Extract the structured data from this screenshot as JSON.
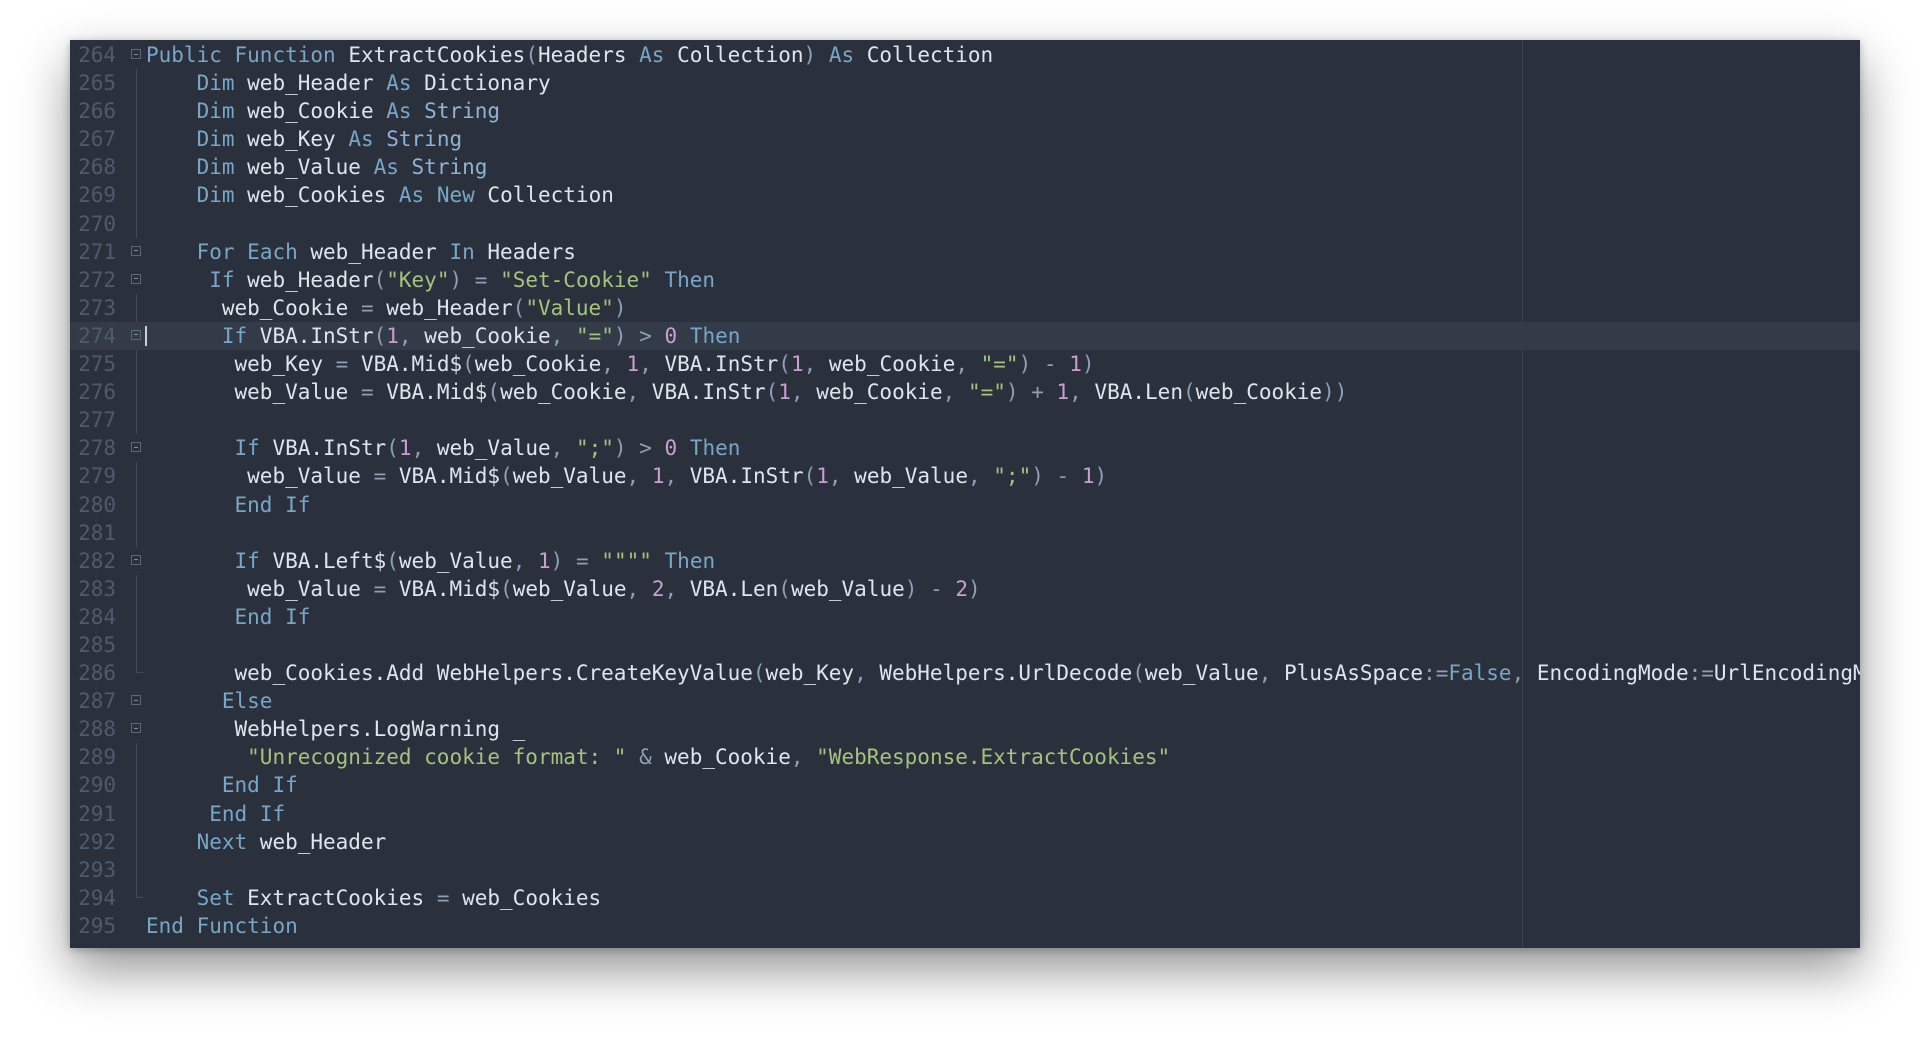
{
  "editor": {
    "language": "VBA",
    "current_line": "274",
    "lines": [
      {
        "num": "264",
        "fold": "start",
        "indent": "",
        "tokens": [
          [
            "kw",
            "Public"
          ],
          [
            "id",
            " "
          ],
          [
            "kw",
            "Function"
          ],
          [
            "id",
            " ExtractCookies"
          ],
          [
            "op",
            "("
          ],
          [
            "id",
            "Headers "
          ],
          [
            "kw",
            "As"
          ],
          [
            "id",
            " Collection"
          ],
          [
            "op",
            ")"
          ],
          [
            "id",
            " "
          ],
          [
            "kw",
            "As"
          ],
          [
            "id",
            " Collection"
          ]
        ]
      },
      {
        "num": "265",
        "fold": "line",
        "indent": "    ",
        "tokens": [
          [
            "kw",
            "Dim"
          ],
          [
            "id",
            " web_Header "
          ],
          [
            "kw",
            "As"
          ],
          [
            "id",
            " Dictionary"
          ]
        ]
      },
      {
        "num": "266",
        "fold": "line",
        "indent": "    ",
        "tokens": [
          [
            "kw",
            "Dim"
          ],
          [
            "id",
            " web_Cookie "
          ],
          [
            "kw",
            "As"
          ],
          [
            "kw2",
            " String"
          ]
        ]
      },
      {
        "num": "267",
        "fold": "line",
        "indent": "    ",
        "tokens": [
          [
            "kw",
            "Dim"
          ],
          [
            "id",
            " web_Key "
          ],
          [
            "kw",
            "As"
          ],
          [
            "kw2",
            " String"
          ]
        ]
      },
      {
        "num": "268",
        "fold": "line",
        "indent": "    ",
        "tokens": [
          [
            "kw",
            "Dim"
          ],
          [
            "id",
            " web_Value "
          ],
          [
            "kw",
            "As"
          ],
          [
            "kw2",
            " String"
          ]
        ]
      },
      {
        "num": "269",
        "fold": "line",
        "indent": "    ",
        "tokens": [
          [
            "kw",
            "Dim"
          ],
          [
            "id",
            " web_Cookies "
          ],
          [
            "kw",
            "As"
          ],
          [
            "id",
            " "
          ],
          [
            "kw",
            "New"
          ],
          [
            "id",
            " Collection"
          ]
        ]
      },
      {
        "num": "270",
        "fold": "line",
        "indent": "",
        "tokens": []
      },
      {
        "num": "271",
        "fold": "start",
        "indent": "    ",
        "tokens": [
          [
            "kw",
            "For"
          ],
          [
            "id",
            " "
          ],
          [
            "kw",
            "Each"
          ],
          [
            "id",
            " web_Header "
          ],
          [
            "kw",
            "In"
          ],
          [
            "id",
            " Headers"
          ]
        ]
      },
      {
        "num": "272",
        "fold": "start",
        "indent": "     ",
        "tokens": [
          [
            "kw",
            "If"
          ],
          [
            "id",
            " web_Header"
          ],
          [
            "op",
            "("
          ],
          [
            "str",
            "\"Key\""
          ],
          [
            "op",
            ")"
          ],
          [
            "id",
            " "
          ],
          [
            "op",
            "="
          ],
          [
            "id",
            " "
          ],
          [
            "str",
            "\"Set-Cookie\""
          ],
          [
            "id",
            " "
          ],
          [
            "kw",
            "Then"
          ]
        ]
      },
      {
        "num": "273",
        "fold": "line",
        "indent": "      ",
        "tokens": [
          [
            "id",
            "web_Cookie "
          ],
          [
            "op",
            "="
          ],
          [
            "id",
            " web_Header"
          ],
          [
            "op",
            "("
          ],
          [
            "str",
            "\"Value\""
          ],
          [
            "op",
            ")"
          ]
        ]
      },
      {
        "num": "274",
        "fold": "start",
        "indent": "      ",
        "tokens": [
          [
            "kw",
            "If"
          ],
          [
            "id",
            " VBA.InStr"
          ],
          [
            "op",
            "("
          ],
          [
            "num",
            "1"
          ],
          [
            "op",
            ","
          ],
          [
            "id",
            " web_Cookie"
          ],
          [
            "op",
            ","
          ],
          [
            "id",
            " "
          ],
          [
            "str",
            "\"=\""
          ],
          [
            "op",
            ")"
          ],
          [
            "id",
            " "
          ],
          [
            "op",
            ">"
          ],
          [
            "id",
            " "
          ],
          [
            "num",
            "0"
          ],
          [
            "id",
            " "
          ],
          [
            "kw",
            "Then"
          ]
        ]
      },
      {
        "num": "275",
        "fold": "line",
        "indent": "       ",
        "tokens": [
          [
            "id",
            "web_Key "
          ],
          [
            "op",
            "="
          ],
          [
            "id",
            " VBA.Mid$"
          ],
          [
            "op",
            "("
          ],
          [
            "id",
            "web_Cookie"
          ],
          [
            "op",
            ","
          ],
          [
            "id",
            " "
          ],
          [
            "num",
            "1"
          ],
          [
            "op",
            ","
          ],
          [
            "id",
            " VBA.InStr"
          ],
          [
            "op",
            "("
          ],
          [
            "num",
            "1"
          ],
          [
            "op",
            ","
          ],
          [
            "id",
            " web_Cookie"
          ],
          [
            "op",
            ","
          ],
          [
            "id",
            " "
          ],
          [
            "str",
            "\"=\""
          ],
          [
            "op",
            ")"
          ],
          [
            "id",
            " "
          ],
          [
            "op",
            "-"
          ],
          [
            "id",
            " "
          ],
          [
            "num",
            "1"
          ],
          [
            "op",
            ")"
          ]
        ]
      },
      {
        "num": "276",
        "fold": "line",
        "indent": "       ",
        "tokens": [
          [
            "id",
            "web_Value "
          ],
          [
            "op",
            "="
          ],
          [
            "id",
            " VBA.Mid$"
          ],
          [
            "op",
            "("
          ],
          [
            "id",
            "web_Cookie"
          ],
          [
            "op",
            ","
          ],
          [
            "id",
            " VBA.InStr"
          ],
          [
            "op",
            "("
          ],
          [
            "num",
            "1"
          ],
          [
            "op",
            ","
          ],
          [
            "id",
            " web_Cookie"
          ],
          [
            "op",
            ","
          ],
          [
            "id",
            " "
          ],
          [
            "str",
            "\"=\""
          ],
          [
            "op",
            ")"
          ],
          [
            "id",
            " "
          ],
          [
            "op",
            "+"
          ],
          [
            "id",
            " "
          ],
          [
            "num",
            "1"
          ],
          [
            "op",
            ","
          ],
          [
            "id",
            " VBA.Len"
          ],
          [
            "op",
            "("
          ],
          [
            "id",
            "web_Cookie"
          ],
          [
            "op",
            "))"
          ]
        ]
      },
      {
        "num": "277",
        "fold": "line",
        "indent": "",
        "tokens": []
      },
      {
        "num": "278",
        "fold": "start",
        "indent": "       ",
        "tokens": [
          [
            "kw",
            "If"
          ],
          [
            "id",
            " VBA.InStr"
          ],
          [
            "op",
            "("
          ],
          [
            "num",
            "1"
          ],
          [
            "op",
            ","
          ],
          [
            "id",
            " web_Value"
          ],
          [
            "op",
            ","
          ],
          [
            "id",
            " "
          ],
          [
            "str",
            "\";\""
          ],
          [
            "op",
            ")"
          ],
          [
            "id",
            " "
          ],
          [
            "op",
            ">"
          ],
          [
            "id",
            " "
          ],
          [
            "num",
            "0"
          ],
          [
            "id",
            " "
          ],
          [
            "kw",
            "Then"
          ]
        ]
      },
      {
        "num": "279",
        "fold": "line",
        "indent": "        ",
        "tokens": [
          [
            "id",
            "web_Value "
          ],
          [
            "op",
            "="
          ],
          [
            "id",
            " VBA.Mid$"
          ],
          [
            "op",
            "("
          ],
          [
            "id",
            "web_Value"
          ],
          [
            "op",
            ","
          ],
          [
            "id",
            " "
          ],
          [
            "num",
            "1"
          ],
          [
            "op",
            ","
          ],
          [
            "id",
            " VBA.InStr"
          ],
          [
            "op",
            "("
          ],
          [
            "num",
            "1"
          ],
          [
            "op",
            ","
          ],
          [
            "id",
            " web_Value"
          ],
          [
            "op",
            ","
          ],
          [
            "id",
            " "
          ],
          [
            "str",
            "\";\""
          ],
          [
            "op",
            ")"
          ],
          [
            "id",
            " "
          ],
          [
            "op",
            "-"
          ],
          [
            "id",
            " "
          ],
          [
            "num",
            "1"
          ],
          [
            "op",
            ")"
          ]
        ]
      },
      {
        "num": "280",
        "fold": "line",
        "indent": "       ",
        "tokens": [
          [
            "kw",
            "End"
          ],
          [
            "id",
            " "
          ],
          [
            "kw",
            "If"
          ]
        ]
      },
      {
        "num": "281",
        "fold": "line",
        "indent": "",
        "tokens": []
      },
      {
        "num": "282",
        "fold": "start",
        "indent": "       ",
        "tokens": [
          [
            "kw",
            "If"
          ],
          [
            "id",
            " VBA.Left$"
          ],
          [
            "op",
            "("
          ],
          [
            "id",
            "web_Value"
          ],
          [
            "op",
            ","
          ],
          [
            "id",
            " "
          ],
          [
            "num",
            "1"
          ],
          [
            "op",
            ")"
          ],
          [
            "id",
            " "
          ],
          [
            "op",
            "="
          ],
          [
            "id",
            " "
          ],
          [
            "str",
            "\"\"\"\""
          ],
          [
            "id",
            " "
          ],
          [
            "kw",
            "Then"
          ]
        ]
      },
      {
        "num": "283",
        "fold": "line",
        "indent": "        ",
        "tokens": [
          [
            "id",
            "web_Value "
          ],
          [
            "op",
            "="
          ],
          [
            "id",
            " VBA.Mid$"
          ],
          [
            "op",
            "("
          ],
          [
            "id",
            "web_Value"
          ],
          [
            "op",
            ","
          ],
          [
            "id",
            " "
          ],
          [
            "num",
            "2"
          ],
          [
            "op",
            ","
          ],
          [
            "id",
            " VBA.Len"
          ],
          [
            "op",
            "("
          ],
          [
            "id",
            "web_Value"
          ],
          [
            "op",
            ")"
          ],
          [
            "id",
            " "
          ],
          [
            "op",
            "-"
          ],
          [
            "id",
            " "
          ],
          [
            "num",
            "2"
          ],
          [
            "op",
            ")"
          ]
        ]
      },
      {
        "num": "284",
        "fold": "line",
        "indent": "       ",
        "tokens": [
          [
            "kw",
            "End"
          ],
          [
            "id",
            " "
          ],
          [
            "kw",
            "If"
          ]
        ]
      },
      {
        "num": "285",
        "fold": "line",
        "indent": "",
        "tokens": []
      },
      {
        "num": "286",
        "fold": "end",
        "indent": "       ",
        "tokens": [
          [
            "id",
            "web_Cookies.Add WebHelpers.CreateKeyValue"
          ],
          [
            "op",
            "("
          ],
          [
            "id",
            "web_Key"
          ],
          [
            "op",
            ","
          ],
          [
            "id",
            " WebHelpers.UrlDecode"
          ],
          [
            "op",
            "("
          ],
          [
            "id",
            "web_Value"
          ],
          [
            "op",
            ","
          ],
          [
            "id",
            " PlusAsSpace"
          ],
          [
            "op",
            ":="
          ],
          [
            "kw",
            "False"
          ],
          [
            "op",
            ","
          ],
          [
            "id",
            " EncodingMode"
          ],
          [
            "op",
            ":="
          ],
          [
            "id",
            "UrlEncodingMode.CookieUrlEncoding"
          ],
          [
            "op",
            "))"
          ]
        ]
      },
      {
        "num": "287",
        "fold": "start",
        "indent": "      ",
        "tokens": [
          [
            "kw",
            "Else"
          ]
        ]
      },
      {
        "num": "288",
        "fold": "start",
        "indent": "       ",
        "tokens": [
          [
            "id",
            "WebHelpers.LogWarning _"
          ]
        ]
      },
      {
        "num": "289",
        "fold": "line",
        "indent": "        ",
        "tokens": [
          [
            "str",
            "\"Unrecognized cookie format: \""
          ],
          [
            "id",
            " "
          ],
          [
            "op",
            "&"
          ],
          [
            "id",
            " web_Cookie"
          ],
          [
            "op",
            ","
          ],
          [
            "id",
            " "
          ],
          [
            "str",
            "\"WebResponse.ExtractCookies\""
          ]
        ]
      },
      {
        "num": "290",
        "fold": "line",
        "indent": "      ",
        "tokens": [
          [
            "kw",
            "End"
          ],
          [
            "id",
            " "
          ],
          [
            "kw",
            "If"
          ]
        ]
      },
      {
        "num": "291",
        "fold": "line",
        "indent": "     ",
        "tokens": [
          [
            "kw",
            "End"
          ],
          [
            "id",
            " "
          ],
          [
            "kw",
            "If"
          ]
        ]
      },
      {
        "num": "292",
        "fold": "line",
        "indent": "    ",
        "tokens": [
          [
            "kw",
            "Next"
          ],
          [
            "id",
            " web_Header"
          ]
        ]
      },
      {
        "num": "293",
        "fold": "line",
        "indent": "",
        "tokens": []
      },
      {
        "num": "294",
        "fold": "end",
        "indent": "    ",
        "tokens": [
          [
            "kw",
            "Set"
          ],
          [
            "id",
            " ExtractCookies "
          ],
          [
            "op",
            "="
          ],
          [
            "id",
            " web_Cookies"
          ]
        ]
      },
      {
        "num": "295",
        "fold": "none",
        "indent": "",
        "tokens": [
          [
            "kw",
            "End"
          ],
          [
            "id",
            " "
          ],
          [
            "kw",
            "Function"
          ]
        ]
      }
    ]
  }
}
